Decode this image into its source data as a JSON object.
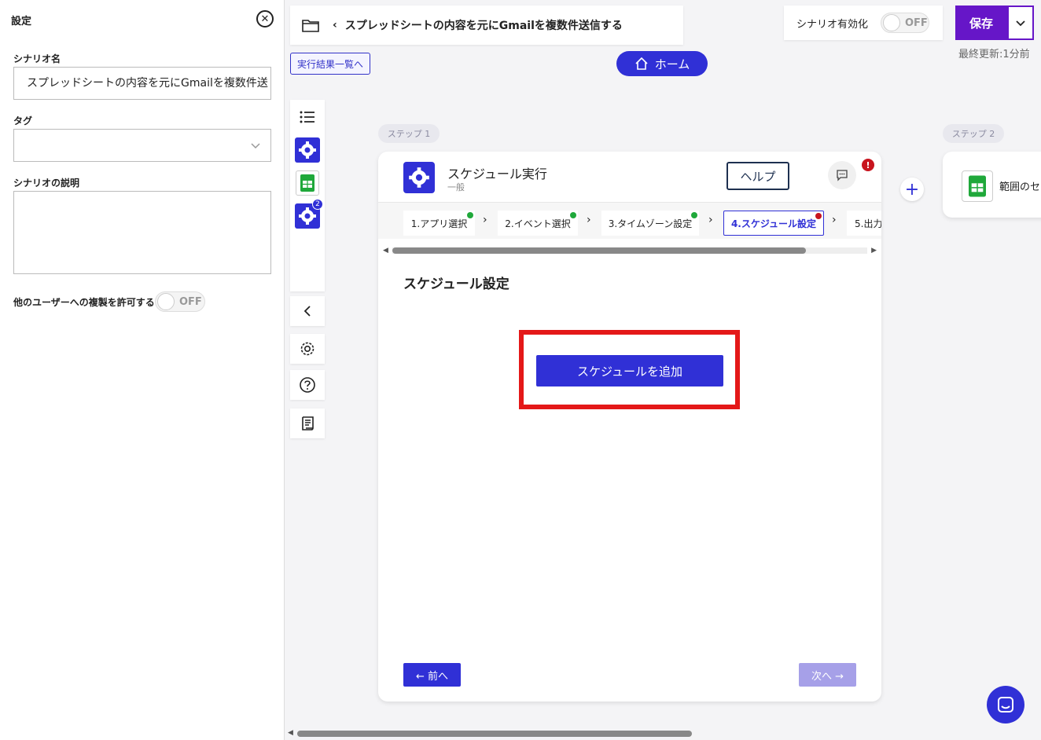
{
  "settings": {
    "title": "設定",
    "scenario_name_label": "シナリオ名",
    "scenario_name_value": "スプレッドシートの内容を元にGmailを複数件送",
    "tag_label": "タグ",
    "description_label": "シナリオの説明",
    "allow_copy_label": "他のユーザーへの複製を許可する",
    "allow_copy_toggle": "OFF"
  },
  "header": {
    "back_glyph": "‹",
    "scenario_title": "スプレッドシートの内容を元にGmailを複数件送信する",
    "results_link": "実行結果一覧へ",
    "home_label": "ホーム",
    "enable_label": "シナリオ有効化",
    "enable_toggle": "OFF",
    "save_label": "保存",
    "last_updated": "最終更新:1分前"
  },
  "sidebar": {
    "step_badge": "2"
  },
  "steps": {
    "step1_chip": "ステップ 1",
    "step2_chip": "ステップ 2"
  },
  "step_card": {
    "app_name": "スケジュール実行",
    "app_sub": "一般",
    "help_label": "ヘルプ",
    "alert_glyph": "!",
    "tabs": [
      {
        "label": "1.アプリ選択"
      },
      {
        "label": "2.イベント選択"
      },
      {
        "label": "3.タイムゾーン設定"
      },
      {
        "label": "4.スケジュール設定"
      },
      {
        "label": "5.出力"
      }
    ],
    "section_title": "スケジュール設定",
    "add_button": "スケジュールを追加",
    "prev_button": "← 前へ",
    "next_button": "次へ →"
  },
  "step2": {
    "name": "範囲のセ"
  },
  "colors": {
    "primary": "#3030d6",
    "save": "#6616c8",
    "highlight": "#e41818",
    "success": "#1fa83a",
    "error": "#c8141e"
  }
}
